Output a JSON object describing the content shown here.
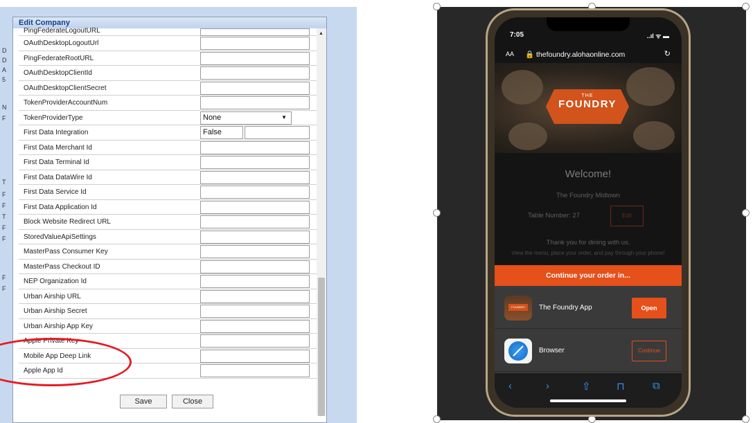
{
  "dialog": {
    "title": "Edit Company",
    "rows": [
      {
        "label": "PingFederateLogoutURL",
        "value": ""
      },
      {
        "label": "OAuthDesktopLogoutUrl",
        "value": ""
      },
      {
        "label": "PingFederateRootURL",
        "value": ""
      },
      {
        "label": "OAuthDesktopClientId",
        "value": ""
      },
      {
        "label": "OAuthDesktopClientSecret",
        "value": ""
      },
      {
        "label": "TokenProviderAccountNum",
        "value": ""
      },
      {
        "label": "TokenProviderType",
        "value": "None",
        "type": "select"
      },
      {
        "label": "First Data Integration",
        "value": "False",
        "type": "bool"
      },
      {
        "label": "First Data Merchant Id",
        "value": ""
      },
      {
        "label": "First Data Terminal Id",
        "value": ""
      },
      {
        "label": "First Data DataWire Id",
        "value": ""
      },
      {
        "label": "First Data Service Id",
        "value": ""
      },
      {
        "label": "First Data Application Id",
        "value": ""
      },
      {
        "label": "Block Website Redirect URL",
        "value": ""
      },
      {
        "label": "StoredValueApiSettings",
        "value": ""
      },
      {
        "label": "MasterPass Consumer Key",
        "value": ""
      },
      {
        "label": "MasterPass Checkout ID",
        "value": ""
      },
      {
        "label": "NEP Organization Id",
        "value": ""
      },
      {
        "label": "Urban Airship URL",
        "value": ""
      },
      {
        "label": "Urban Airship Secret",
        "value": ""
      },
      {
        "label": "Urban Airship App Key",
        "value": ""
      },
      {
        "label": "Apple Private Key",
        "value": ""
      },
      {
        "label": "Mobile App Deep Link",
        "value": ""
      },
      {
        "label": "Apple App Id",
        "value": ""
      }
    ],
    "save_label": "Save",
    "close_label": "Close",
    "side_letters": [
      "D",
      "D",
      "A",
      "5",
      "N",
      "F",
      "T",
      "F",
      "F",
      "T",
      "F",
      "F",
      "F",
      "F"
    ]
  },
  "phone": {
    "status_time": "7:05",
    "status_icons": "..ıl ᯤ ▬",
    "url_aa": "AA",
    "url": "🔒 thefoundry.alohaonline.com",
    "reload_icon": "↻",
    "logo_the": "THE",
    "logo_name": "FOUNDRY",
    "welcome": "Welcome!",
    "location": "The Foundry Midtown",
    "table_label": "Table Number: 27",
    "edit_label": "Edit",
    "thanks": "Thank you for dining with us.",
    "instructions": "View the menu, place your order, and pay through your phone!",
    "sheet_header": "Continue your order in...",
    "app_label": "The Foundry App",
    "app_icon_text": "FOUNDRY",
    "open_label": "Open",
    "browser_label": "Browser",
    "continue_label": "Continue",
    "toolbar": {
      "back": "‹",
      "forward": "›",
      "share": "⇧",
      "bookmarks": "⊓",
      "tabs": "⧉"
    }
  },
  "colors": {
    "accent": "#e5501b",
    "annotation": "#e51b24",
    "dialog_title": "#15428b"
  }
}
